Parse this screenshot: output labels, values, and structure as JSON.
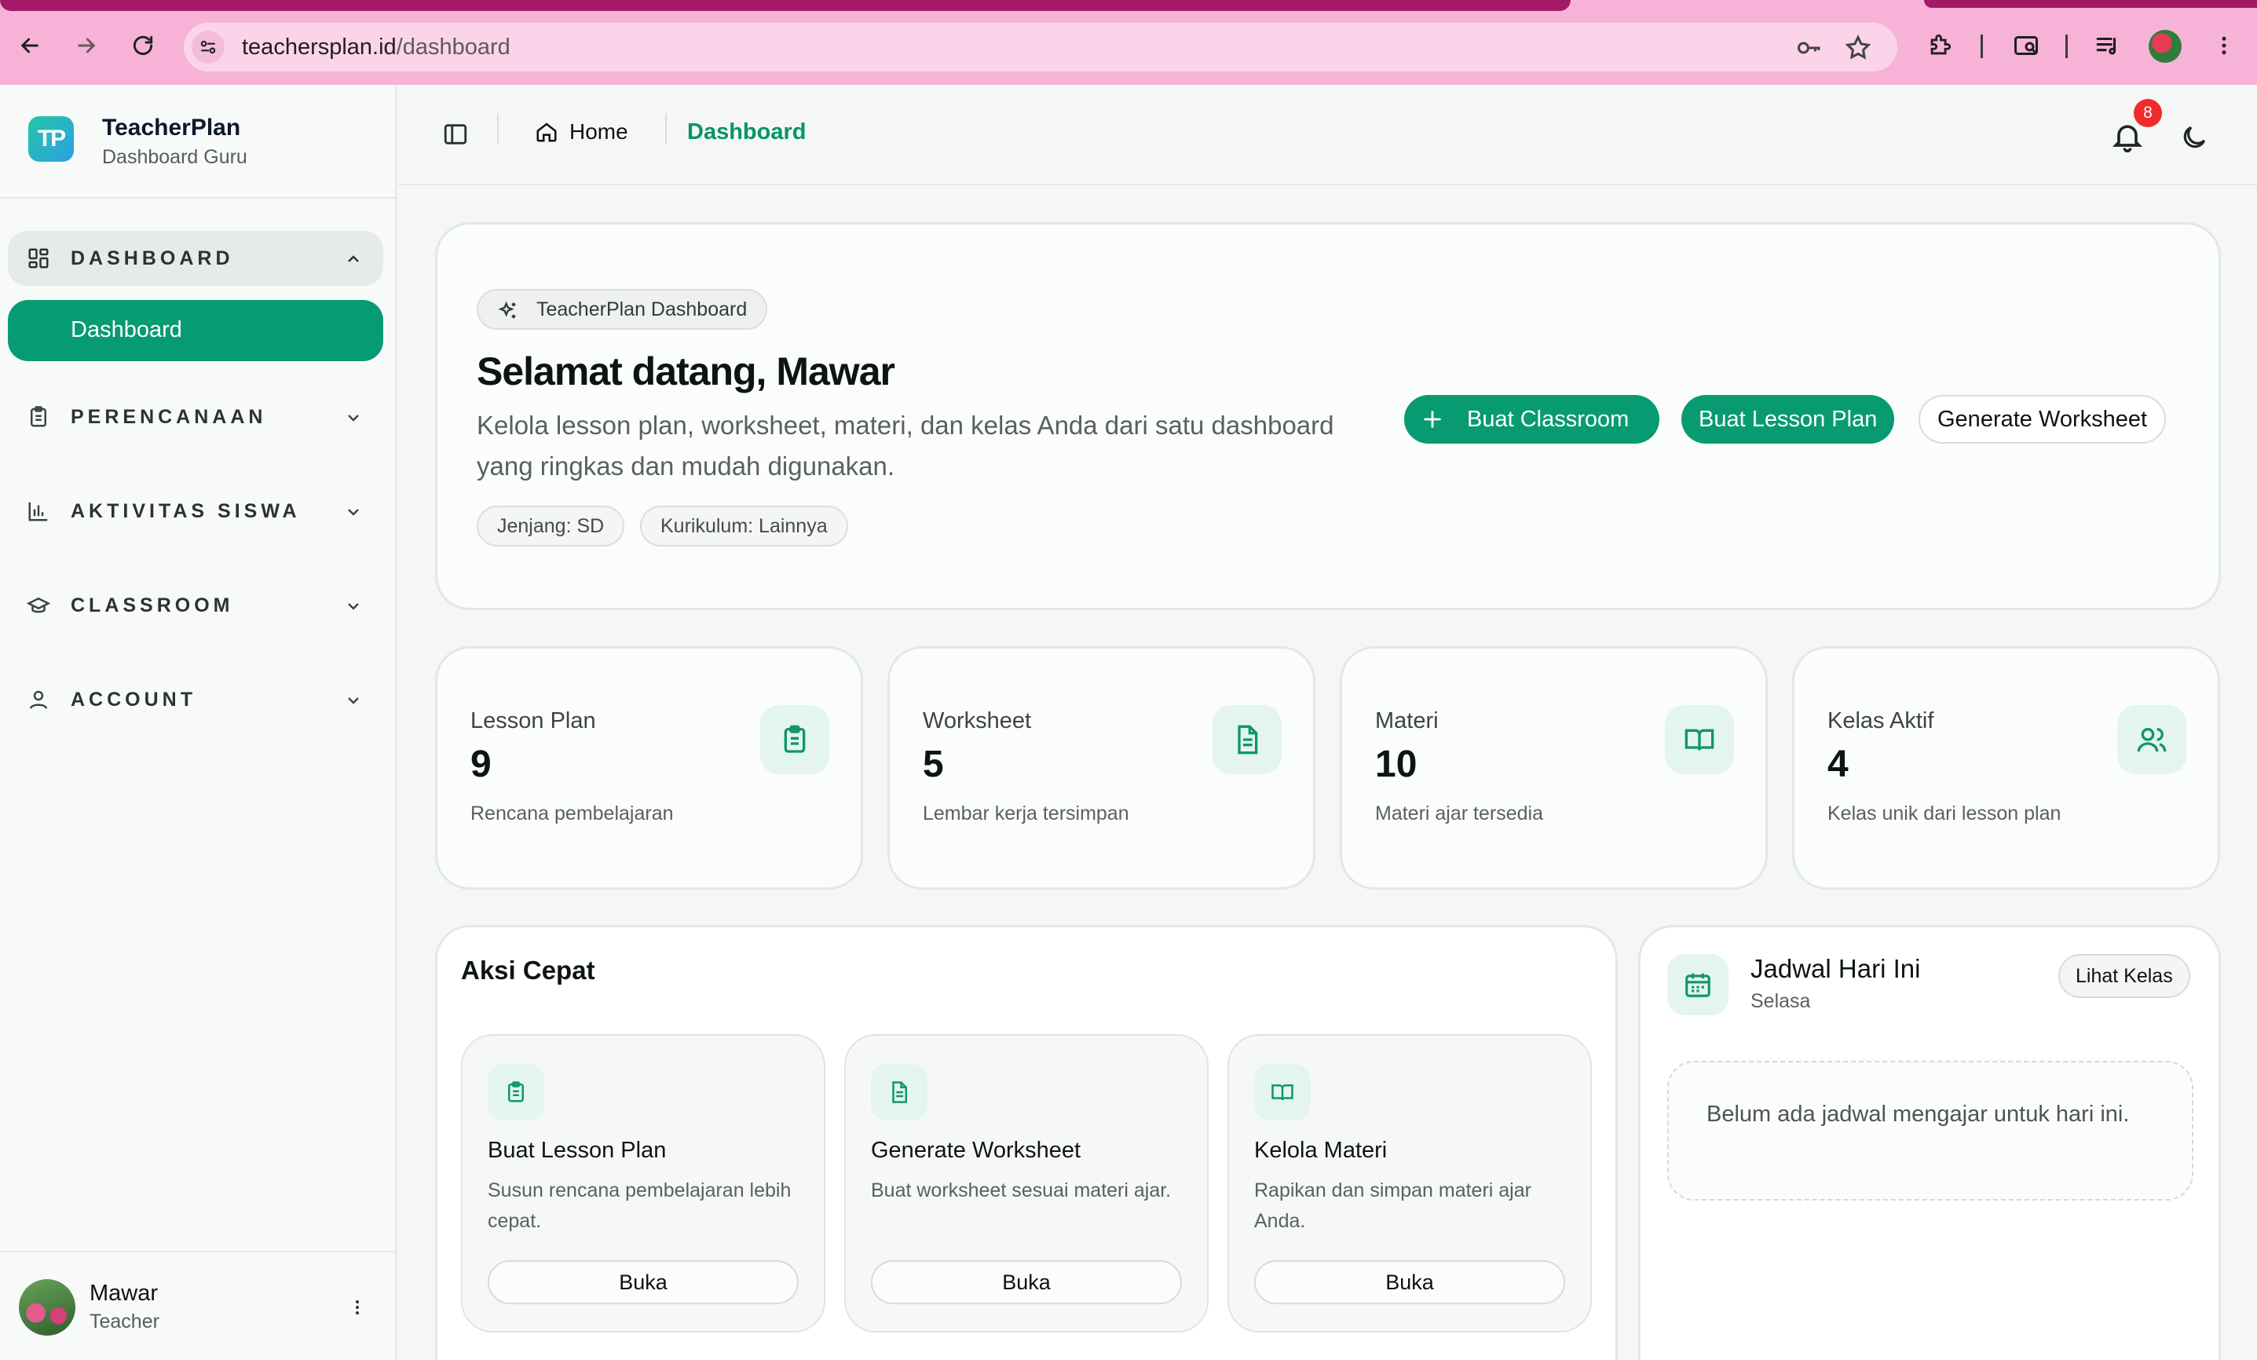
{
  "browser": {
    "url_host": "teachersplan.id",
    "url_path": "/dashboard"
  },
  "brand": {
    "name": "TeacherPlan",
    "subtitle": "Dashboard Guru",
    "logo_text": "TP"
  },
  "sidebar": {
    "groups": [
      {
        "label": "DASHBOARD",
        "icon": "layout-grid-icon",
        "expanded": true
      },
      {
        "label": "PERENCANAAN",
        "icon": "clipboard-icon",
        "expanded": false
      },
      {
        "label": "AKTIVITAS SISWA",
        "icon": "bar-chart-icon",
        "expanded": false
      },
      {
        "label": "CLASSROOM",
        "icon": "graduation-cap-icon",
        "expanded": false
      },
      {
        "label": "ACCOUNT",
        "icon": "user-icon",
        "expanded": false
      }
    ],
    "active_item": "Dashboard"
  },
  "user": {
    "name": "Mawar",
    "role": "Teacher"
  },
  "header": {
    "breadcrumb_home": "Home",
    "breadcrumb_current": "Dashboard",
    "notification_count": "8"
  },
  "hero": {
    "chip": "TeacherPlan Dashboard",
    "title": "Selamat datang, Mawar",
    "description": "Kelola lesson plan, worksheet, materi, dan kelas Anda dari satu dashboard yang ringkas dan mudah digunakan.",
    "tags": [
      "Jenjang: SD",
      "Kurikulum: Lainnya"
    ],
    "buttons": {
      "create_classroom": "Buat Classroom",
      "create_lesson_plan": "Buat Lesson Plan",
      "generate_worksheet": "Generate Worksheet"
    }
  },
  "stats": [
    {
      "label": "Lesson Plan",
      "value": "9",
      "sub": "Rencana pembelajaran",
      "icon": "clipboard-icon"
    },
    {
      "label": "Worksheet",
      "value": "5",
      "sub": "Lembar kerja tersimpan",
      "icon": "file-text-icon"
    },
    {
      "label": "Materi",
      "value": "10",
      "sub": "Materi ajar tersedia",
      "icon": "book-open-icon"
    },
    {
      "label": "Kelas Aktif",
      "value": "4",
      "sub": "Kelas unik dari lesson plan",
      "icon": "users-icon"
    }
  ],
  "quick_actions": {
    "title": "Aksi Cepat",
    "items": [
      {
        "title": "Buat Lesson Plan",
        "desc": "Susun rencana pembelajaran lebih cepat.",
        "button": "Buka",
        "icon": "clipboard-icon"
      },
      {
        "title": "Generate Worksheet",
        "desc": "Buat worksheet sesuai materi ajar.",
        "button": "Buka",
        "icon": "file-text-icon"
      },
      {
        "title": "Kelola Materi",
        "desc": "Rapikan dan simpan materi ajar Anda.",
        "button": "Buka",
        "icon": "book-open-icon"
      }
    ]
  },
  "schedule": {
    "title": "Jadwal Hari Ini",
    "day": "Selasa",
    "button": "Lihat Kelas",
    "empty": "Belum ada jadwal mengajar untuk hari ini."
  },
  "colors": {
    "brand_green": "#089b71",
    "chrome_pink": "#f7b3d7",
    "badge_red": "#ef2b2b"
  }
}
